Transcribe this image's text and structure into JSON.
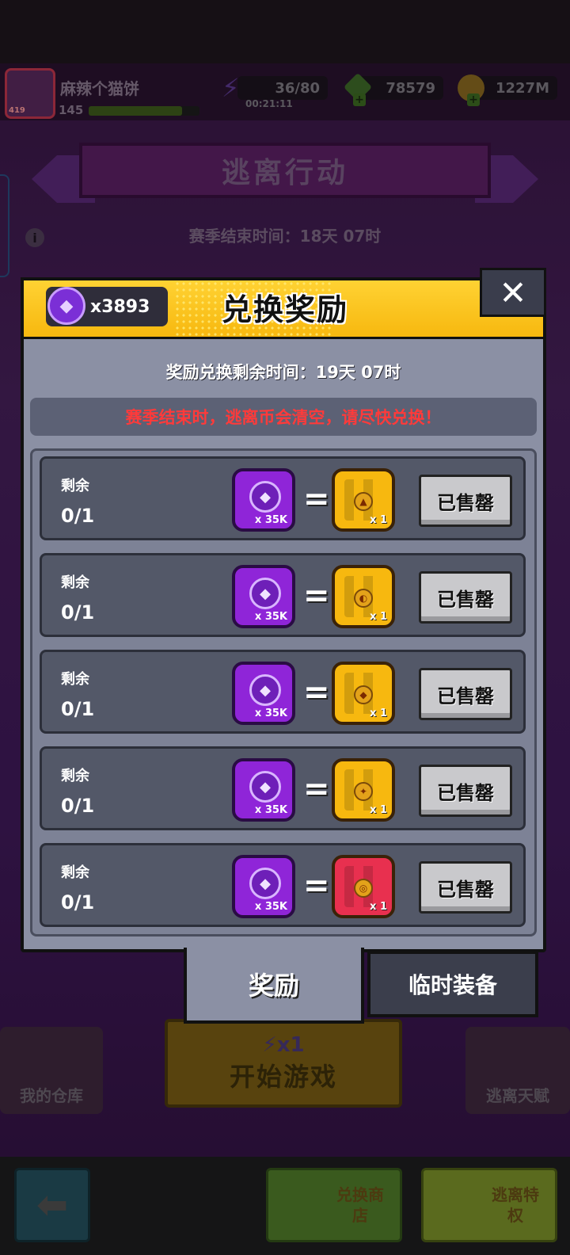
{
  "hud": {
    "player_name": "麻辣个猫饼",
    "player_level": "145",
    "avatar_level": "419",
    "energy": "36/80",
    "energy_timer": "00:21:11",
    "cubes": "78579",
    "coins": "1227M",
    "energy_icon": "⚡",
    "plus": "+"
  },
  "background": {
    "banner_title": "逃离行动",
    "season_end": "赛季结束时间：18天 07时",
    "info": "i",
    "start_energy": "⚡x1",
    "start_label": "开始游戏",
    "warehouse": "我的仓库",
    "talent": "逃离天赋",
    "back": "⬅",
    "exchange_shop": "兑换商店",
    "escape_privilege": "逃离特权"
  },
  "modal": {
    "gem_count": "x3893",
    "gem_icon": "◆",
    "title": "兑换奖励",
    "close": "✕",
    "remaining_time": "奖励兑换剩余时间：19天 07时",
    "warning": "赛季结束时，逃离币会清空，请尽快兑换！",
    "rows": [
      {
        "label": "剩余",
        "count": "0/1",
        "cost_amount": "x 35K",
        "equals": "=",
        "reward_qty": "x 1",
        "button": "已售罄",
        "reward_color": "#f7b80f",
        "emblem": "▲"
      },
      {
        "label": "剩余",
        "count": "0/1",
        "cost_amount": "x 35K",
        "equals": "=",
        "reward_qty": "x 1",
        "button": "已售罄",
        "reward_color": "#f7b80f",
        "emblem": "◐"
      },
      {
        "label": "剩余",
        "count": "0/1",
        "cost_amount": "x 35K",
        "equals": "=",
        "reward_qty": "x 1",
        "button": "已售罄",
        "reward_color": "#f7b80f",
        "emblem": "◆"
      },
      {
        "label": "剩余",
        "count": "0/1",
        "cost_amount": "x 35K",
        "equals": "=",
        "reward_qty": "x 1",
        "button": "已售罄",
        "reward_color": "#f7b80f",
        "emblem": "✦"
      },
      {
        "label": "剩余",
        "count": "0/1",
        "cost_amount": "x 35K",
        "equals": "=",
        "reward_qty": "x 1",
        "button": "已售罄",
        "reward_color": "#e8304f",
        "emblem": "◎"
      }
    ],
    "tabs": {
      "rewards": "奖励",
      "temp_equipment": "临时装备"
    }
  }
}
